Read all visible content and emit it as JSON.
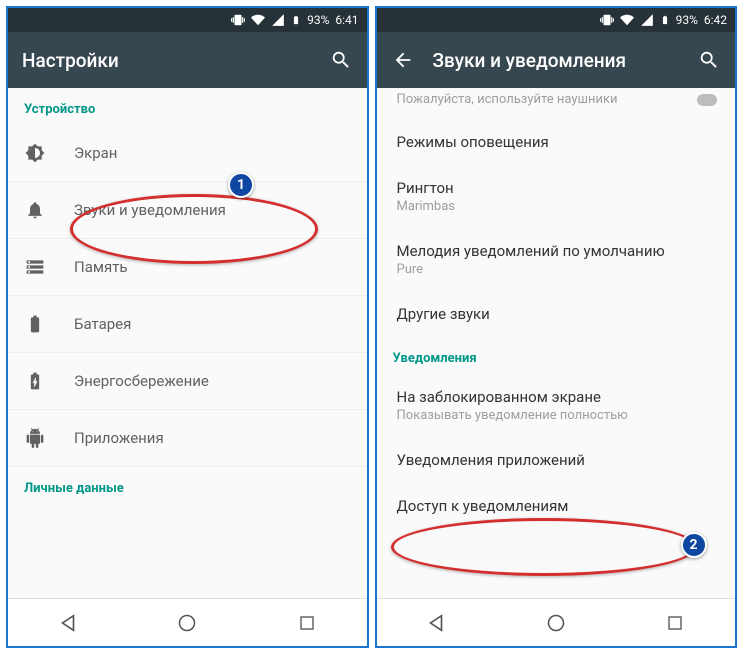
{
  "left": {
    "status": {
      "battery": "93%",
      "time": "6:41"
    },
    "appbar": {
      "title": "Настройки"
    },
    "section1": "Устройство",
    "items": [
      {
        "label": "Экран"
      },
      {
        "label": "Звуки и уведомления"
      },
      {
        "label": "Память"
      },
      {
        "label": "Батарея"
      },
      {
        "label": "Энергосбережение"
      },
      {
        "label": "Приложения"
      }
    ],
    "section2": "Личные данные",
    "callout": "1"
  },
  "right": {
    "status": {
      "battery": "93%",
      "time": "6:42"
    },
    "appbar": {
      "title": "Звуки и уведомления"
    },
    "partial_hint": "Пожалуйста, используйте наушники",
    "items": [
      {
        "primary": "Режимы оповещения"
      },
      {
        "primary": "Рингтон",
        "secondary": "Marimbas"
      },
      {
        "primary": "Мелодия уведомлений по умолчанию",
        "secondary": "Pure"
      },
      {
        "primary": "Другие звуки"
      }
    ],
    "section": "Уведомления",
    "items2": [
      {
        "primary": "На заблокированном экране",
        "secondary": "Показывать уведомление полностью"
      },
      {
        "primary": "Уведомления приложений"
      },
      {
        "primary": "Доступ к уведомлениям"
      }
    ],
    "callout": "2"
  }
}
